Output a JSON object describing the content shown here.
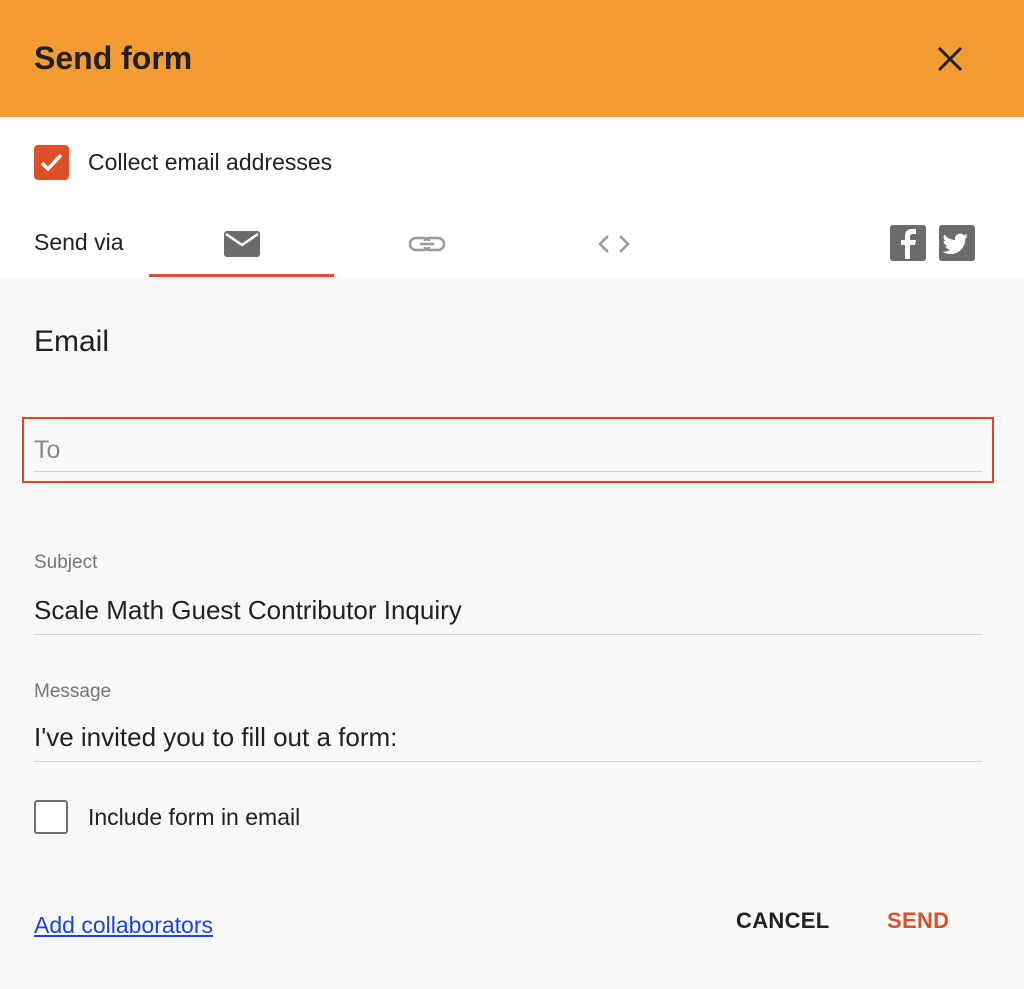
{
  "dialog": {
    "title": "Send form",
    "close_icon": "close-icon",
    "header_color": "#f39c34",
    "accent_color": "#dd5027"
  },
  "collect_emails": {
    "label": "Collect email addresses",
    "checked": true
  },
  "send_via": {
    "label": "Send via",
    "tabs": [
      {
        "icon": "email-icon",
        "selected": true
      },
      {
        "icon": "link-icon",
        "selected": false
      },
      {
        "icon": "embed-code-icon",
        "selected": false
      }
    ],
    "social": [
      {
        "icon": "facebook-icon"
      },
      {
        "icon": "twitter-icon"
      }
    ]
  },
  "email": {
    "section_title": "Email",
    "to": {
      "placeholder": "To",
      "value": ""
    },
    "subject": {
      "label": "Subject",
      "value": "Scale Math Guest Contributor Inquiry"
    },
    "message": {
      "label": "Message",
      "value": "I've invited you to fill out a form:"
    },
    "include_form": {
      "label": "Include form in email",
      "checked": false
    }
  },
  "footer": {
    "add_collaborators": "Add collaborators",
    "cancel": "CANCEL",
    "send": "SEND"
  }
}
